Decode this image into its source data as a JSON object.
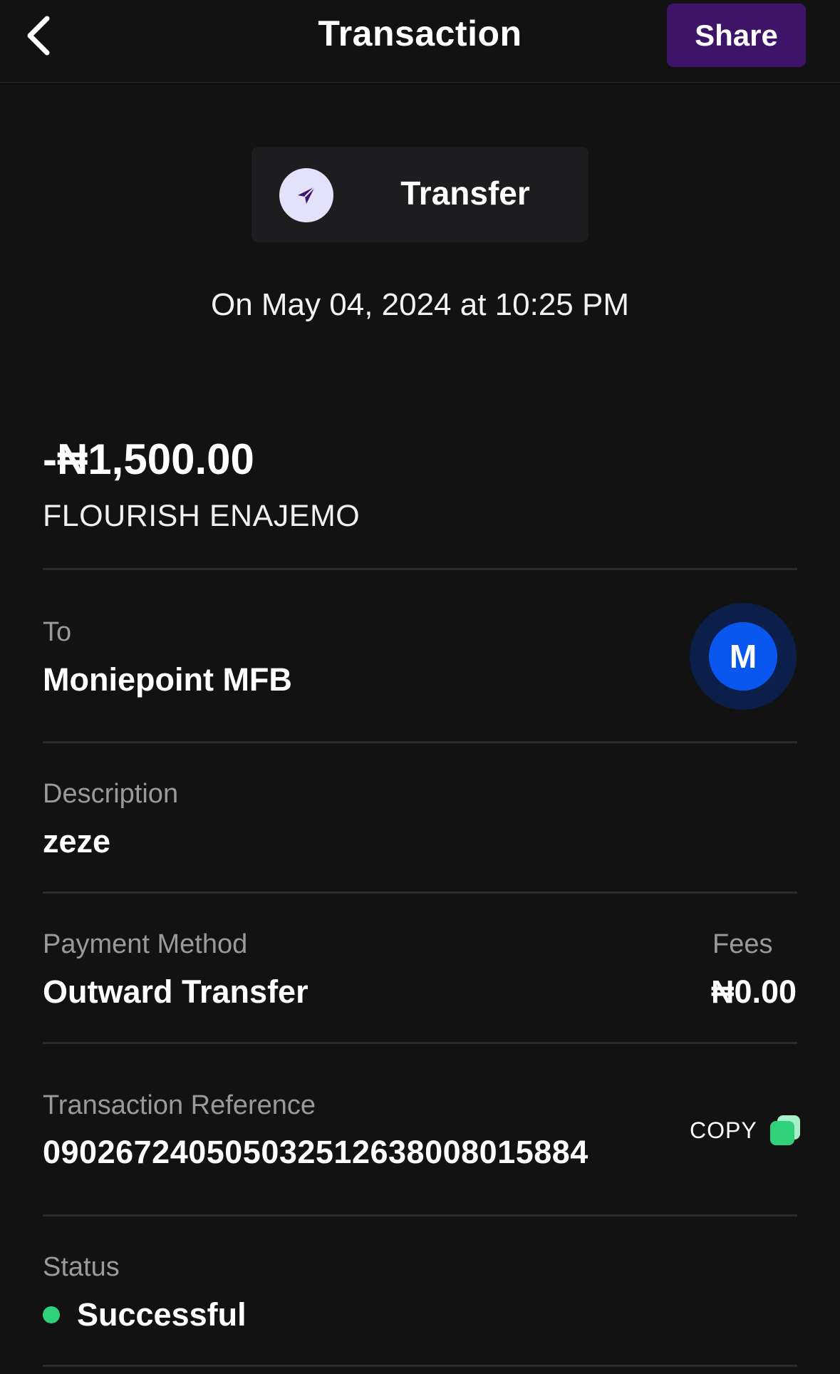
{
  "header": {
    "title": "Transaction",
    "share_label": "Share"
  },
  "transaction_type": {
    "label": "Transfer",
    "icon": "send-arrow-icon"
  },
  "datetime": "On May 04, 2024 at 10:25 PM",
  "amount": "-₦1,500.00",
  "counterparty_name": "FLOURISH ENAJEMO",
  "to": {
    "label": "To",
    "value": "Moniepoint MFB",
    "logo_letter": "M"
  },
  "description": {
    "label": "Description",
    "value": "zeze"
  },
  "payment_method": {
    "label": "Payment Method",
    "value": "Outward Transfer"
  },
  "fees": {
    "label": "Fees",
    "value": "₦0.00"
  },
  "reference": {
    "label": "Transaction Reference",
    "value": "090267240505032512638008015884",
    "copy_label": "COPY"
  },
  "status": {
    "label": "Status",
    "value": "Successful",
    "color": "#2fd17a"
  },
  "colors": {
    "background": "#121212",
    "share_button": "#3d1467",
    "bank_logo": "#0a57f0",
    "copy_icon": "#2fd17a"
  }
}
